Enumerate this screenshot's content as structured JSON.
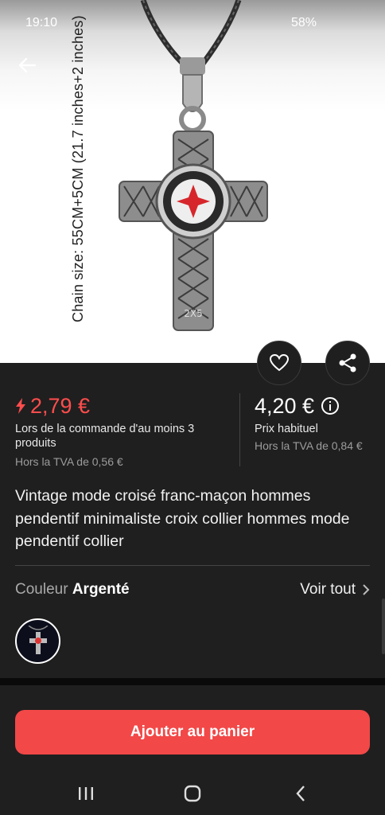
{
  "status": {
    "time": "19:10",
    "battery": "58%"
  },
  "product_image": {
    "chain_size": "Chain size: 55CM+5CM (21.7 inches+2 inches)",
    "engraving": "2X5"
  },
  "pricing": {
    "deal_price": "2,79 €",
    "deal_note": "Lors de la commande d'au moins 3 produits",
    "deal_vat": "Hors la TVA de 0,56 €",
    "regular_price": "4,20 €",
    "regular_note": "Prix habituel",
    "regular_vat": "Hors la TVA de 0,84 €"
  },
  "title": "Vintage mode croisé franc-maçon hommes pendentif minimaliste croix collier hommes mode pendentif collier",
  "variant": {
    "label": "Couleur",
    "value": "Argenté",
    "see_all": "Voir tout"
  },
  "cart_button": "Ajouter au panier",
  "colors": {
    "accent": "#f24848",
    "deal": "#ff4d4d",
    "background": "#1f1f1f"
  }
}
